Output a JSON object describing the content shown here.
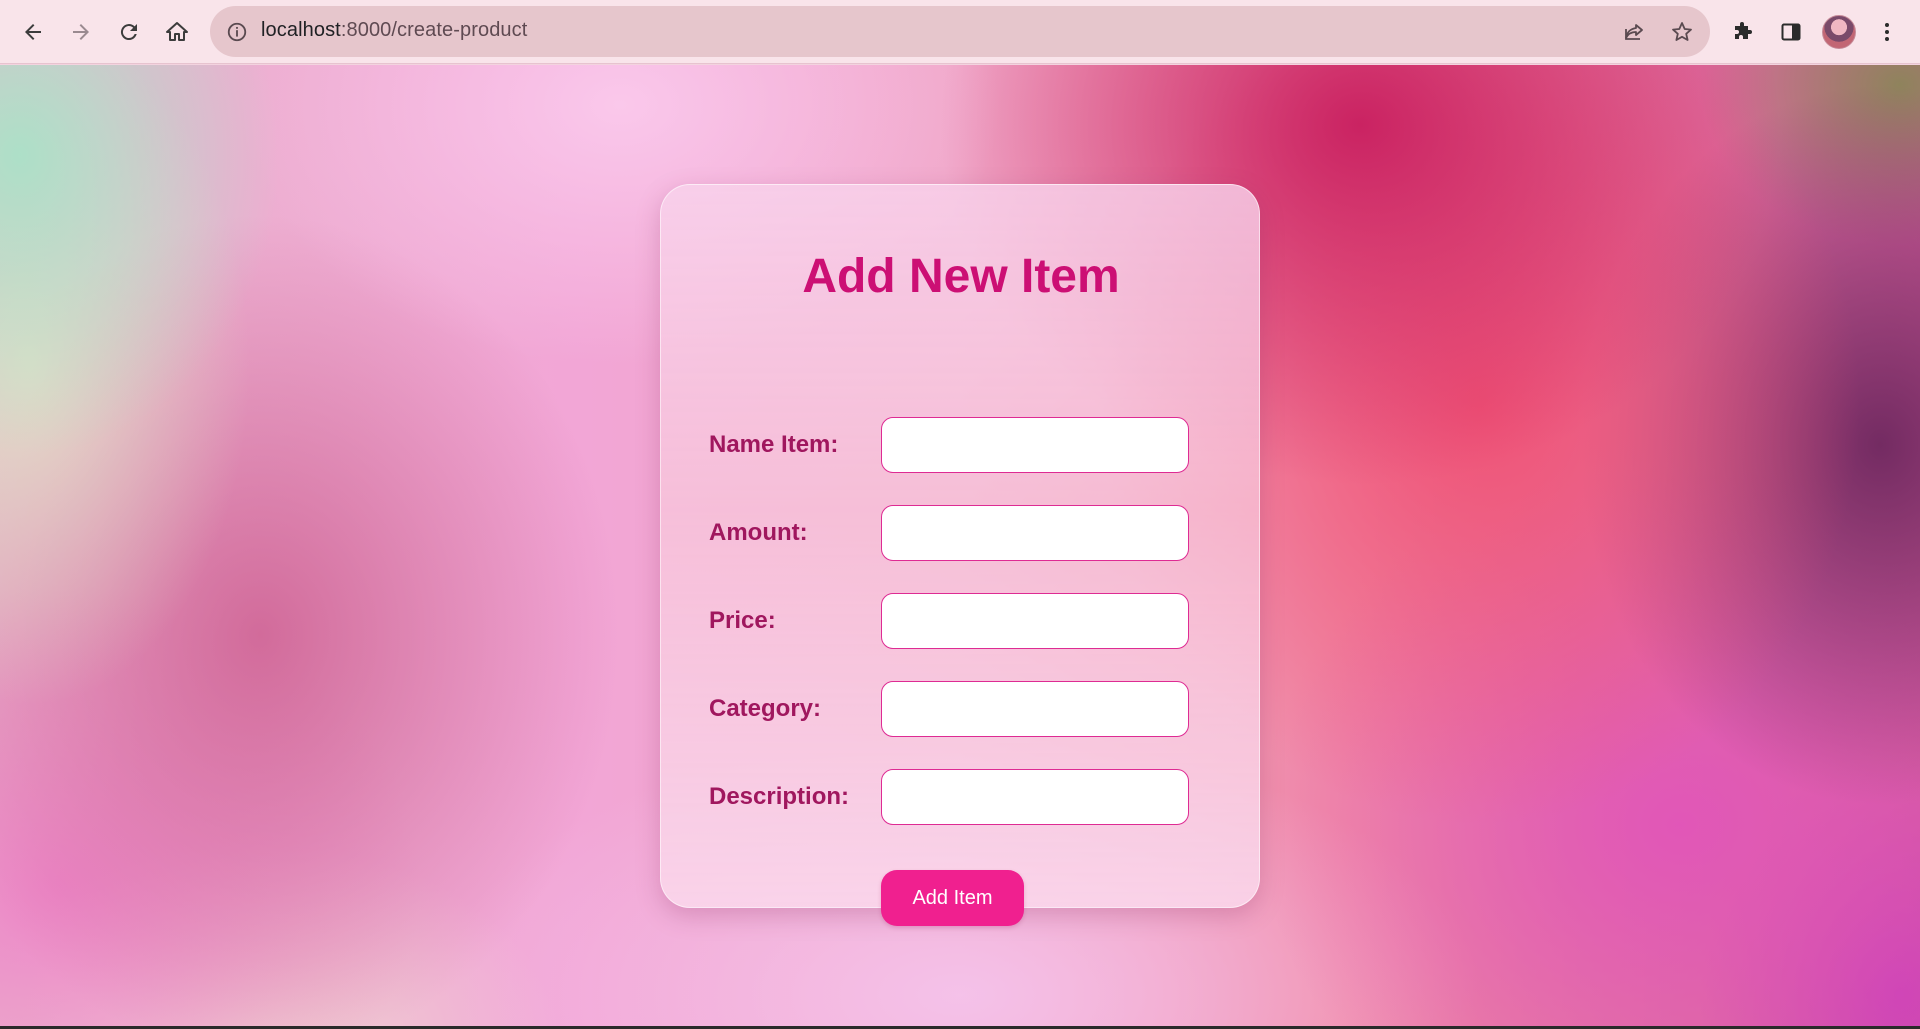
{
  "browser": {
    "url_host": "localhost",
    "url_path": ":8000/create-product",
    "icons": {
      "back": "back-arrow-icon",
      "forward": "forward-arrow-icon",
      "reload": "reload-icon",
      "home": "home-icon",
      "site_info": "info-icon",
      "share": "share-icon",
      "bookmark": "star-icon",
      "extensions": "puzzle-icon",
      "side_panel": "side-panel-icon",
      "menu": "kebab-menu-icon"
    }
  },
  "form": {
    "title": "Add New Item",
    "fields": [
      {
        "label": "Name Item:",
        "value": ""
      },
      {
        "label": "Amount:",
        "value": ""
      },
      {
        "label": "Price:",
        "value": ""
      },
      {
        "label": "Category:",
        "value": ""
      },
      {
        "label": "Description:",
        "value": ""
      }
    ],
    "submit_label": "Add Item"
  },
  "colors": {
    "title": "#cc0f74",
    "label": "#a0175e",
    "button": "#f0208f",
    "input_border": "#de2b93"
  }
}
